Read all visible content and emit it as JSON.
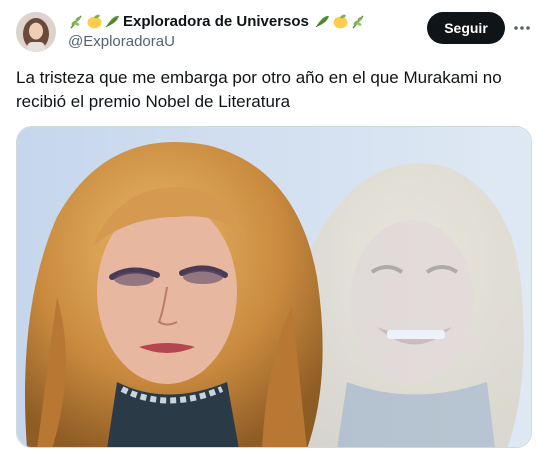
{
  "author": {
    "display_name": "Exploradora de Universos",
    "handle": "@ExploradoraU",
    "lead_emojis": [
      "herb-emoji",
      "lemon-emoji",
      "leaves-emoji"
    ],
    "trail_emojis": [
      "leaves-emoji",
      "lemon-emoji",
      "herb-emoji"
    ]
  },
  "actions": {
    "follow_label": "Seguir",
    "more_icon": "ellipsis-icon"
  },
  "tweet": {
    "text": "La tristeza que me embarga por otro año en el que Murakami no recibió el premio Nobel de Literatura"
  },
  "media": {
    "type": "image",
    "icon": "meme-photo"
  },
  "colors": {
    "text": "#0f1419",
    "secondary": "#536471",
    "button": "#0f1419",
    "border": "#cfd9de"
  }
}
